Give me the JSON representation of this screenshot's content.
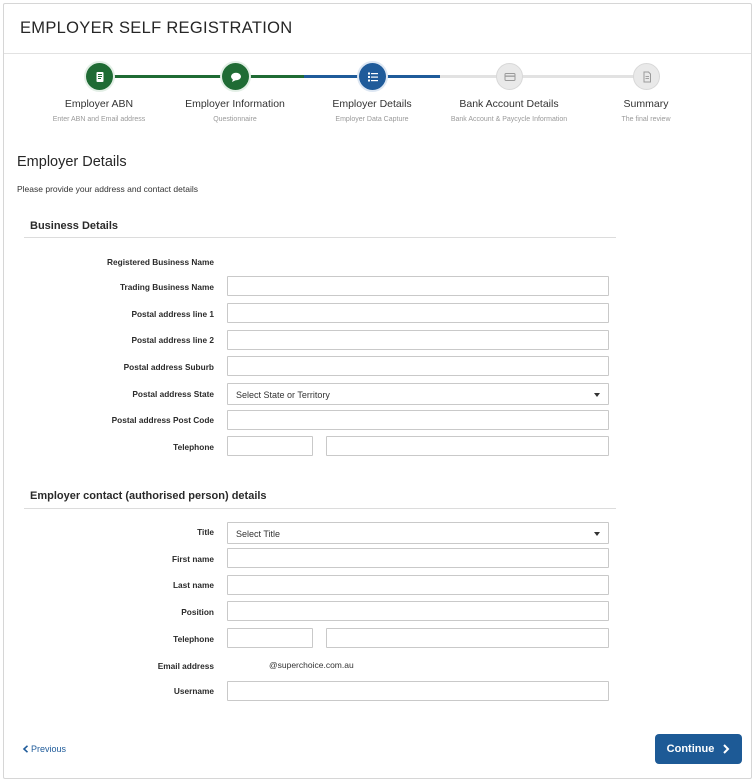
{
  "page": {
    "title": "EMPLOYER SELF REGISTRATION"
  },
  "wizard": {
    "steps": [
      {
        "label": "Employer ABN",
        "sub": "Enter ABN and Email address",
        "state": "done",
        "icon": "document-icon"
      },
      {
        "label": "Employer Information",
        "sub": "Questionnaire",
        "state": "done",
        "icon": "chat-icon"
      },
      {
        "label": "Employer Details",
        "sub": "Employer Data Capture",
        "state": "active",
        "icon": "list-icon"
      },
      {
        "label": "Bank Account Details",
        "sub": "Bank Account & Paycycle Information",
        "state": "future",
        "icon": "card-icon"
      },
      {
        "label": "Summary",
        "sub": "The final review",
        "state": "future",
        "icon": "file-icon"
      }
    ],
    "colors": {
      "done": "#1f6b34",
      "active": "#1f5b9a",
      "future": "#e9e9e9"
    }
  },
  "section": {
    "title": "Employer Details",
    "description": "Please provide your address and contact details"
  },
  "business": {
    "title": "Business Details",
    "registered_name_label": "Registered Business Name",
    "trading_name_label": "Trading Business Name",
    "address1_label": "Postal address line 1",
    "address2_label": "Postal address line 2",
    "suburb_label": "Postal address Suburb",
    "state_label": "Postal address State",
    "state_placeholder": "Select State or Territory",
    "postcode_label": "Postal address Post Code",
    "telephone_label": "Telephone"
  },
  "contact": {
    "title": "Employer contact (authorised person) details",
    "title_label": "Title",
    "title_placeholder": "Select Title",
    "first_name_label": "First name",
    "last_name_label": "Last name",
    "position_label": "Position",
    "telephone_label": "Telephone",
    "email_label": "Email address",
    "email_domain": "@superchoice.com.au",
    "username_label": "Username"
  },
  "actions": {
    "previous": "Previous",
    "continue": "Continue"
  }
}
